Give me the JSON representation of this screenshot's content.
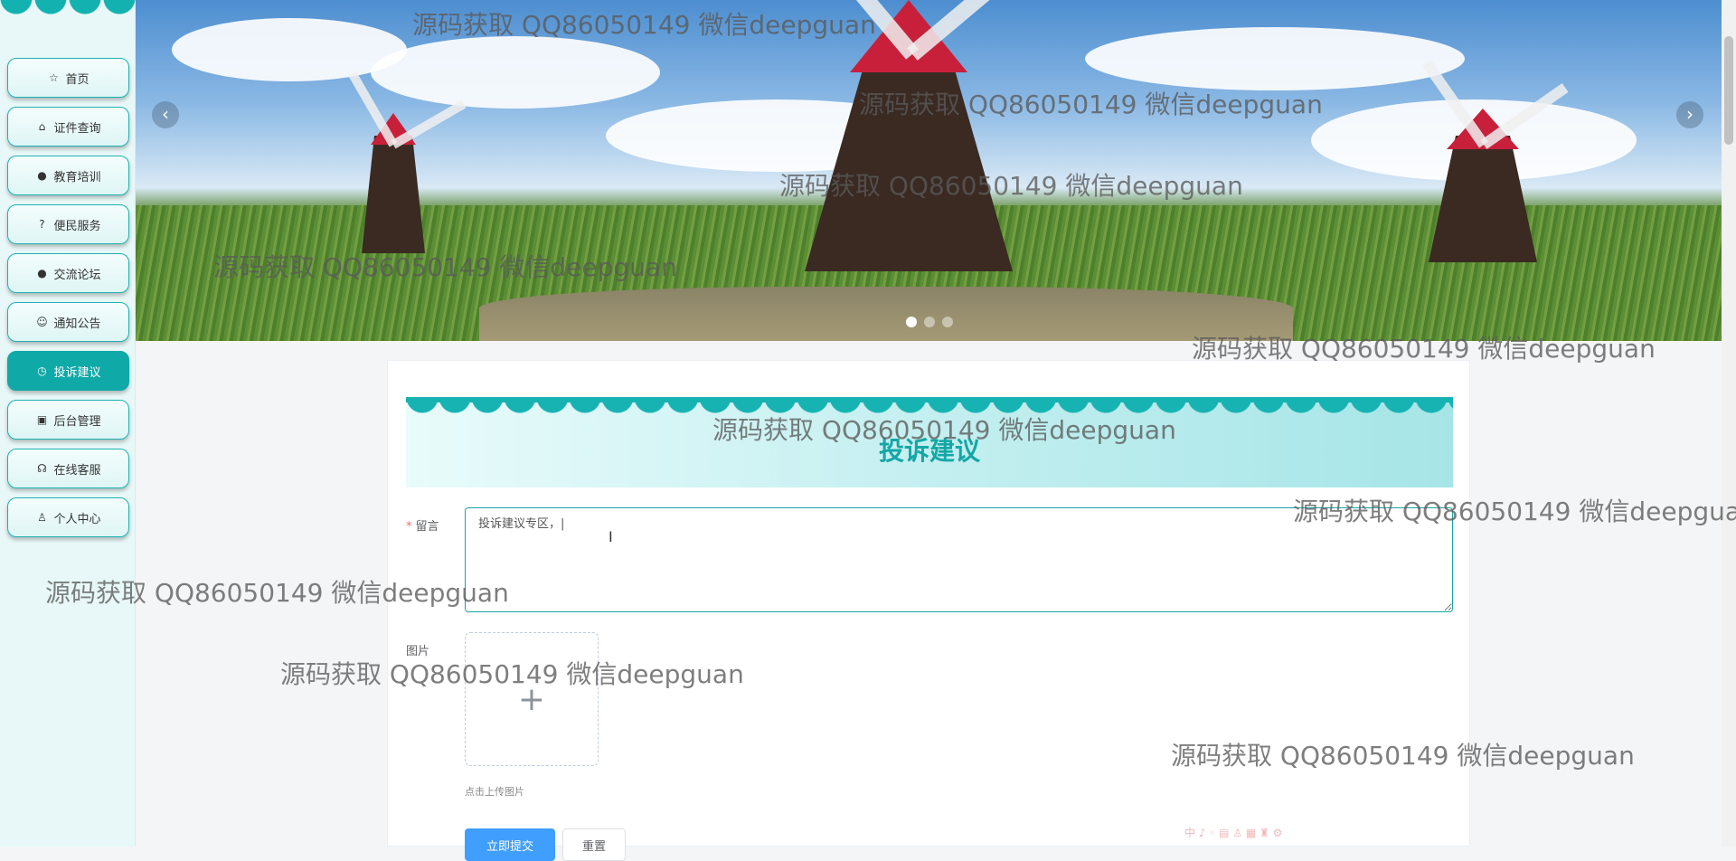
{
  "sidebar": {
    "items": [
      {
        "label": "首页",
        "icon": "star-icon",
        "glyph": "☆",
        "active": false
      },
      {
        "label": "证件查询",
        "icon": "bag-icon",
        "glyph": "⌂",
        "active": false
      },
      {
        "label": "教育培训",
        "icon": "alert-icon",
        "glyph": "●",
        "active": false
      },
      {
        "label": "便民服务",
        "icon": "question-icon",
        "glyph": "?",
        "active": false
      },
      {
        "label": "交流论坛",
        "icon": "info-icon",
        "glyph": "●",
        "active": false
      },
      {
        "label": "通知公告",
        "icon": "smile-icon",
        "glyph": "☺",
        "active": false
      },
      {
        "label": "投诉建议",
        "icon": "clock-icon",
        "glyph": "◷",
        "active": true
      },
      {
        "label": "后台管理",
        "icon": "briefcase-icon",
        "glyph": "▣",
        "active": false
      },
      {
        "label": "在线客服",
        "icon": "headset-icon",
        "glyph": "☊",
        "active": false
      },
      {
        "label": "个人中心",
        "icon": "user-icon",
        "glyph": "♙",
        "active": false
      }
    ]
  },
  "carousel": {
    "prev_glyph": "‹",
    "next_glyph": "›",
    "dots": 3,
    "active_dot": 0
  },
  "form": {
    "title": "投诉建议",
    "message_label": "留言",
    "message_required_mark": "*",
    "message_value": "投诉建议专区，|",
    "image_label": "图片",
    "upload_plus": "+",
    "upload_tip": "点击上传图片",
    "submit_label": "立即提交",
    "reset_label": "重置"
  },
  "ime_toolbar": "中 ♪ ◦ ▤ ♙ ▦ ♜ ⚙",
  "watermark": "源码获取 QQ86050149 微信deepguan"
}
